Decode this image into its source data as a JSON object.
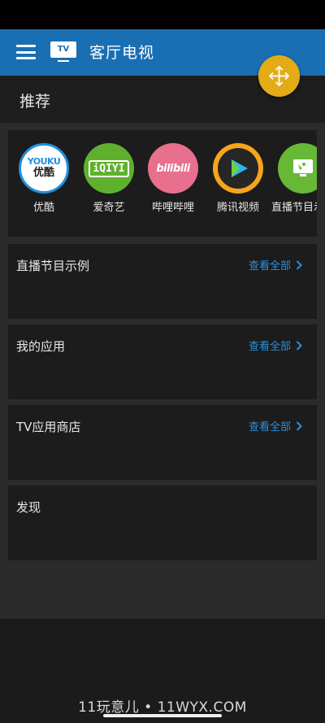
{
  "app_bar": {
    "title": "客厅电视",
    "tv_badge": "TV",
    "color": "#1a6fb3"
  },
  "fab": {
    "icon": "move-arrows-icon",
    "color": "#e3ac17"
  },
  "recommend": {
    "title": "推荐",
    "apps": [
      {
        "label": "优酷",
        "logo_top": "YOUKU",
        "logo_bottom": "优酷"
      },
      {
        "label": "爱奇艺",
        "logo": "iQIYI"
      },
      {
        "label": "哔哩哔哩",
        "logo": "bilibili"
      },
      {
        "label": "腾讯视频",
        "icon": "play-icon"
      },
      {
        "label": "直播节目示例",
        "icon": "satellite-icon"
      }
    ]
  },
  "sections": [
    {
      "title": "直播节目示例",
      "link": "查看全部"
    },
    {
      "title": "我的应用",
      "link": "查看全部"
    },
    {
      "title": "TV应用商店",
      "link": "查看全部"
    },
    {
      "title": "发现"
    }
  ],
  "watermark": "11玩意儿 • 11WYX.COM",
  "colors": {
    "link": "#2d8fdc",
    "background": "#1b1b1b",
    "card": "#1c1c1c"
  }
}
